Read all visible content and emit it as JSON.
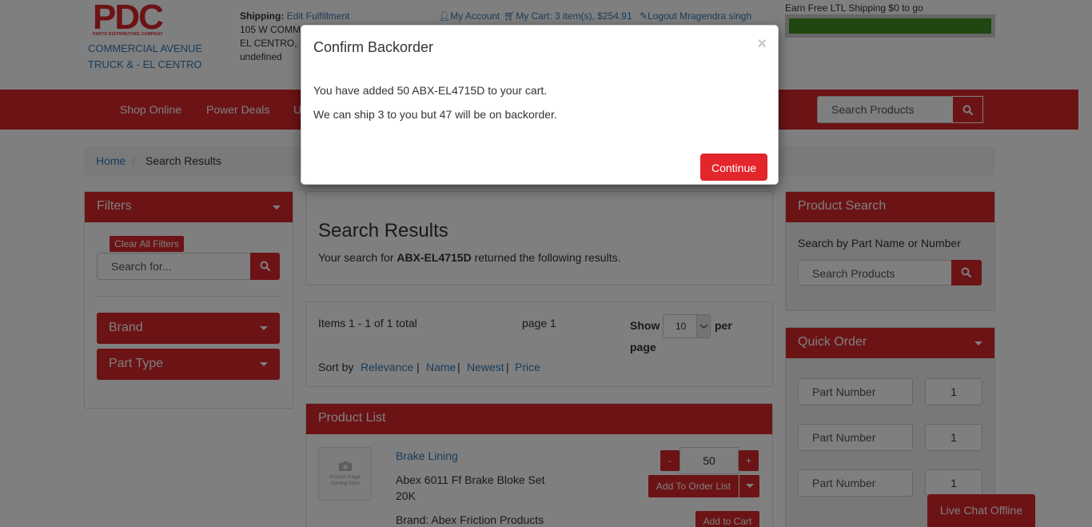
{
  "header": {
    "logo_text": "PDC",
    "logo_subtext": "PARTS DISTRIBUTING COMPANY",
    "store_line1": "COMMERCIAL AVENUE",
    "store_line2": "TRUCK & - EL CENTRO",
    "shipping_label": "Shipping:",
    "shipping_link": "Edit Fulfillment",
    "address_line1": "105 W COMM",
    "address_line2": "EL CENTRO,",
    "address_line3": "undefined",
    "my_account": "My Account",
    "my_cart": "My Cart: 3 item(s), $254.91",
    "logout": "Logout Mragendra singh",
    "ltl_label": "Earn Free LTL Shipping $0 to go",
    "ltl_progress": 1.0
  },
  "nav": {
    "items": [
      "Shop Online",
      "Power Deals",
      "U"
    ],
    "search_placeholder": "Search Products"
  },
  "breadcrumb": {
    "home": "Home",
    "separator": "/",
    "current": "Search Results"
  },
  "filters": {
    "title": "Filters",
    "clear_all": "Clear All Filters",
    "search_placeholder": "Search for...",
    "brand": "Brand",
    "part_type": "Part Type"
  },
  "results": {
    "title": "Search Results",
    "prefix": "Your search for ",
    "query": "ABX-EL4715D",
    "suffix": " returned the following results.",
    "items_text": "Items 1 - 1 of 1 total",
    "page_text": "page 1",
    "show_label": "Show",
    "show_value": "10",
    "per_label": "per",
    "page_label": "page",
    "sort_label": "Sort by",
    "sort_options": [
      "Relevance",
      "Name",
      "Newest",
      "Price"
    ]
  },
  "product_list": {
    "title": "Product List",
    "image_text_line1": "Product Image",
    "image_text_line2": "Coming Soon",
    "category": "Brake Lining",
    "name_line1": "Abex 6011 Ff Brake Bloke Set",
    "name_line2": "20K",
    "brand": "Brand: Abex Friction Products",
    "minus": "-",
    "plus": "+",
    "quantity": "50",
    "add_to_order_list": "Add To Order List",
    "add_to_cart": "Add to Cart"
  },
  "product_search": {
    "title": "Product Search",
    "subtitle": "Search by Part Name or Number",
    "placeholder": "Search Products"
  },
  "quick_order": {
    "title": "Quick Order",
    "rows": [
      {
        "part_placeholder": "Part Number",
        "qty": "1"
      },
      {
        "part_placeholder": "Part Number",
        "qty": "1"
      },
      {
        "part_placeholder": "Part Number",
        "qty": "1"
      }
    ]
  },
  "live_chat": "Live Chat Offline",
  "modal": {
    "title": "Confirm Backorder",
    "close": "×",
    "line1": "You have added 50 ABX-EL4715D to your cart.",
    "line2": "We can ship 3 to you but 47 will be on backorder.",
    "continue": "Continue"
  },
  "colors": {
    "brand_red": "#d9262b",
    "progress_green": "#3e8e1f",
    "link_blue": "#337ab7"
  }
}
